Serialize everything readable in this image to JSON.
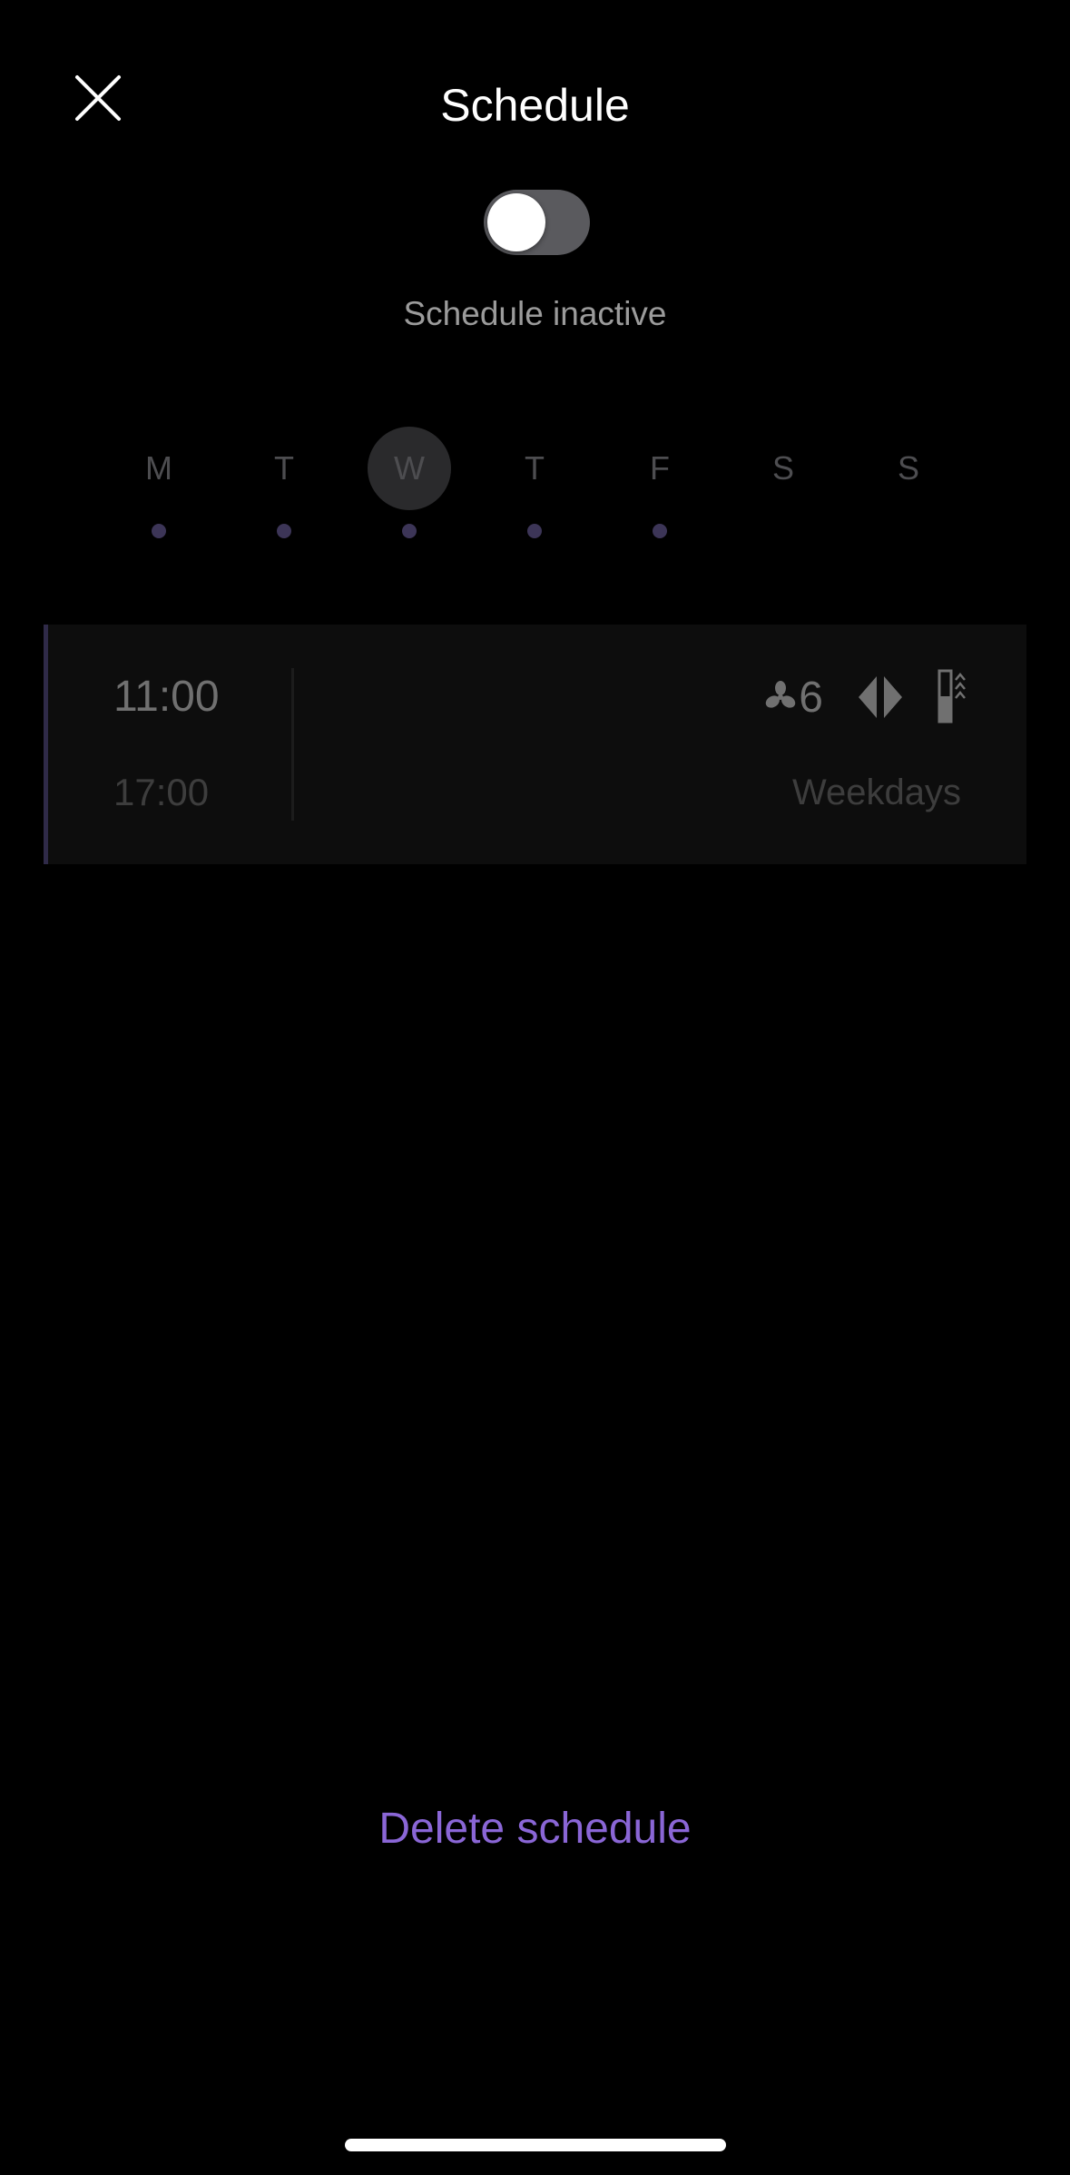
{
  "header": {
    "title": "Schedule",
    "close_icon": "close-icon"
  },
  "toggle": {
    "state": "off",
    "status_text": "Schedule inactive"
  },
  "days": [
    {
      "label": "M",
      "selected": false,
      "has_schedule": true
    },
    {
      "label": "T",
      "selected": false,
      "has_schedule": true
    },
    {
      "label": "W",
      "selected": true,
      "has_schedule": true
    },
    {
      "label": "T",
      "selected": false,
      "has_schedule": true
    },
    {
      "label": "F",
      "selected": false,
      "has_schedule": true
    },
    {
      "label": "S",
      "selected": false,
      "has_schedule": false
    },
    {
      "label": "S",
      "selected": false,
      "has_schedule": false
    }
  ],
  "schedule_item": {
    "start_time": "11:00",
    "end_time": "17:00",
    "fan_icon": "fan-icon",
    "fan_speed": "6",
    "oscillation_icon": "oscillation-icon",
    "heat_icon": "heat-icon",
    "repeat": "Weekdays"
  },
  "actions": {
    "delete_label": "Delete schedule"
  },
  "colors": {
    "background": "#000000",
    "accent": "#8a66d6",
    "dot": "#3c3557",
    "card_bar": "#2f2a48"
  }
}
